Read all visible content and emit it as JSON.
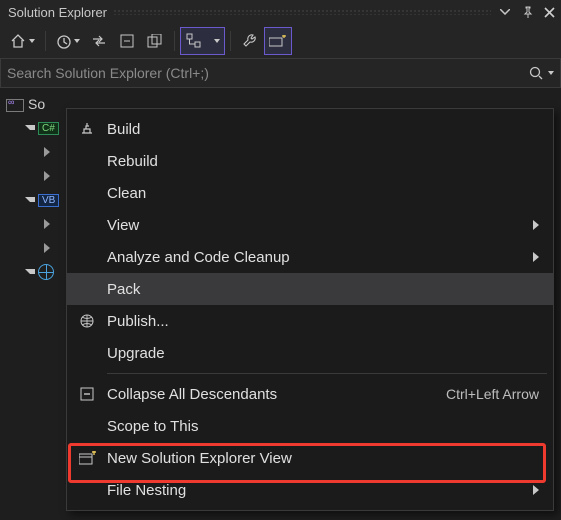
{
  "header": {
    "title": "Solution Explorer"
  },
  "search": {
    "placeholder": "Search Solution Explorer (Ctrl+;)"
  },
  "tree": {
    "solution_prefix": "So",
    "cs_badge": "C#",
    "vb_badge": "VB"
  },
  "context_menu": {
    "items": [
      {
        "label": "Build",
        "icon": "build-icon",
        "submenu": false
      },
      {
        "label": "Rebuild",
        "icon": "",
        "submenu": false
      },
      {
        "label": "Clean",
        "icon": "",
        "submenu": false
      },
      {
        "label": "View",
        "icon": "",
        "submenu": true
      },
      {
        "label": "Analyze and Code Cleanup",
        "icon": "",
        "submenu": true
      },
      {
        "label": "Pack",
        "icon": "",
        "submenu": false,
        "hovered": true
      },
      {
        "label": "Publish...",
        "icon": "publish-icon",
        "submenu": false
      },
      {
        "label": "Upgrade",
        "icon": "",
        "submenu": false
      },
      {
        "sep": true
      },
      {
        "label": "Collapse All Descendants",
        "icon": "collapse-icon",
        "submenu": false,
        "shortcut": "Ctrl+Left Arrow"
      },
      {
        "label": "Scope to This",
        "icon": "",
        "submenu": false
      },
      {
        "label": "New Solution Explorer View",
        "icon": "new-view-icon",
        "submenu": false,
        "highlighted": true
      },
      {
        "label": "File Nesting",
        "icon": "",
        "submenu": true
      }
    ]
  }
}
